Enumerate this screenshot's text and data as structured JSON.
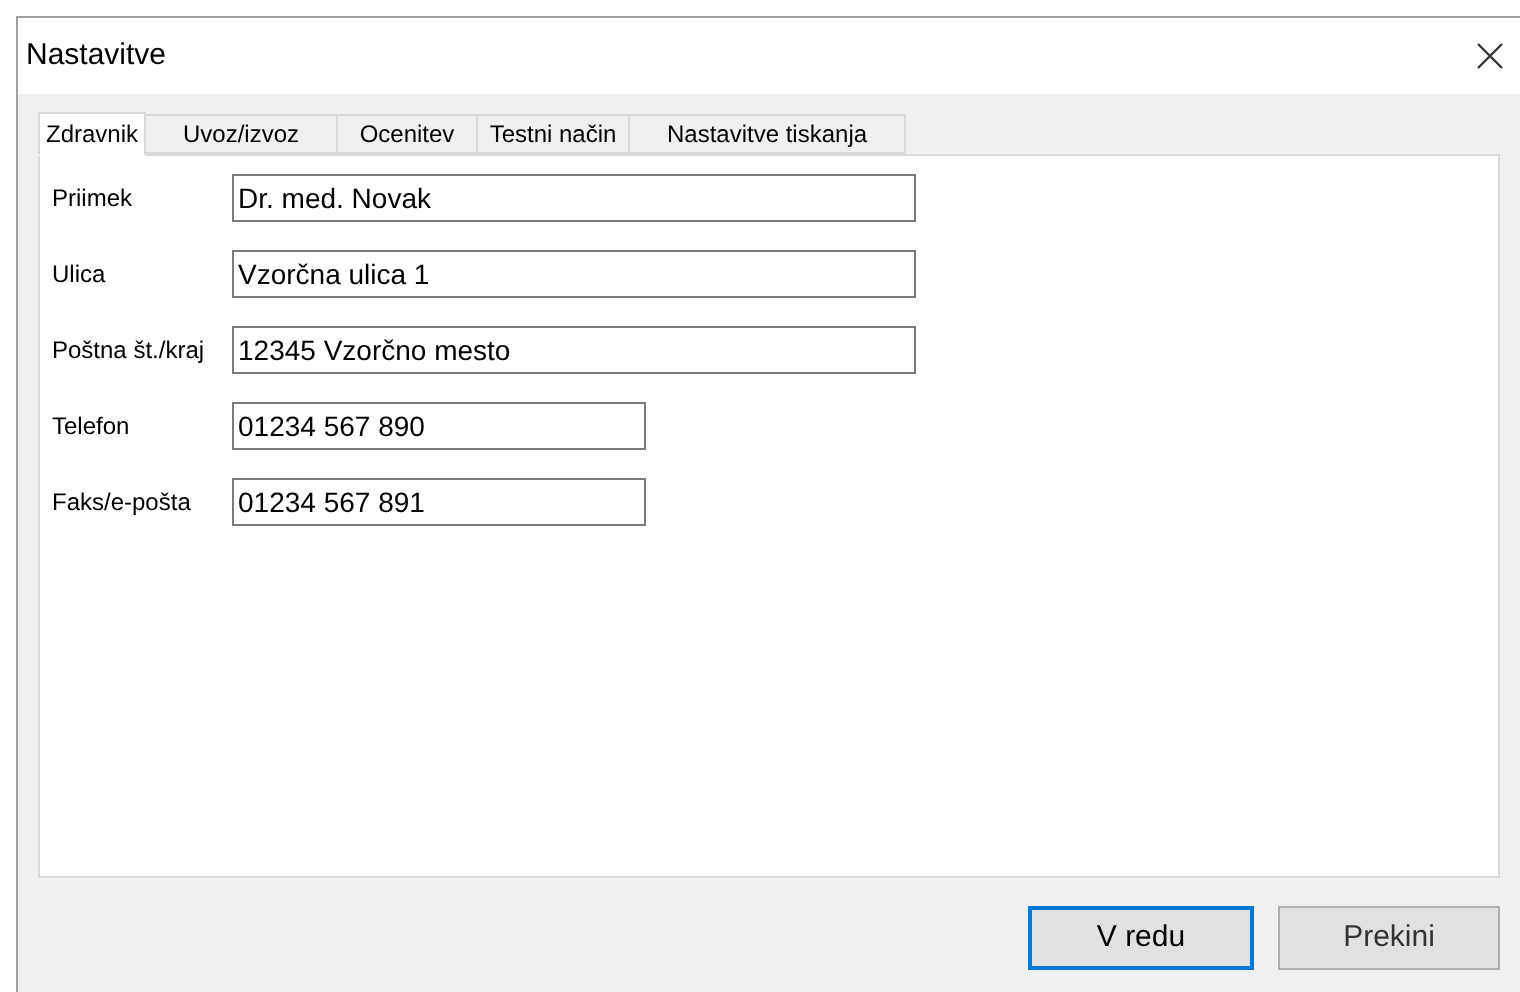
{
  "window": {
    "title": "Nastavitve"
  },
  "tabs": [
    {
      "label": "Zdravnik",
      "selected": true
    },
    {
      "label": "Uvoz/izvoz",
      "selected": false
    },
    {
      "label": "Ocenitev",
      "selected": false
    },
    {
      "label": "Testni način",
      "selected": false
    },
    {
      "label": "Nastavitve tiskanja",
      "selected": false
    }
  ],
  "fields": [
    {
      "label": "Priimek",
      "value": "Dr. med. Novak",
      "kind": "long"
    },
    {
      "label": "Ulica",
      "value": "Vzorčna ulica 1",
      "kind": "long"
    },
    {
      "label": "Poštna št./kraj",
      "value": "12345 Vzorčno mesto",
      "kind": "long"
    },
    {
      "label": "Telefon",
      "value": "01234 567 890",
      "kind": "short"
    },
    {
      "label": "Faks/e-pošta",
      "value": "01234 567 891",
      "kind": "short"
    }
  ],
  "buttons": [
    {
      "label": "V redu",
      "kind": "default"
    },
    {
      "label": "Prekini",
      "kind": "normal"
    }
  ]
}
